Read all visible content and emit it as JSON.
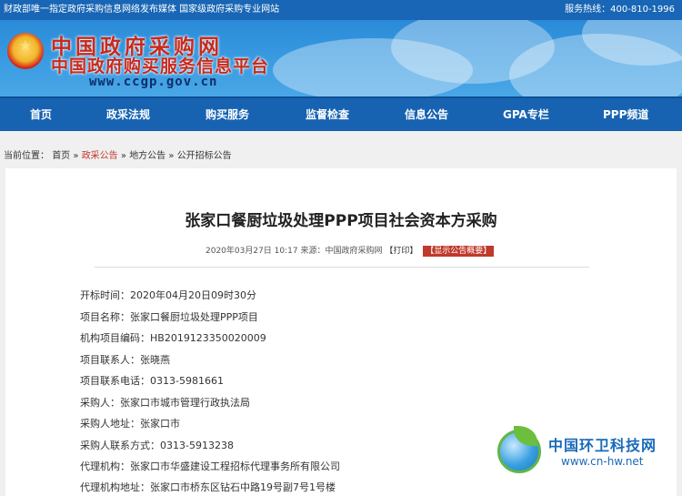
{
  "topbar": {
    "left_text": "财政部唯一指定政府采购信息网络发布媒体 国家级政府采购专业网站",
    "right_text": "服务热线：400-810-1996"
  },
  "banner": {
    "name_line1": "中国政府采购网",
    "name_line2": "中国政府购买服务信息平台",
    "url": "www.ccgp.gov.cn"
  },
  "nav": {
    "items": [
      "首页",
      "政采法规",
      "购买服务",
      "监督检查",
      "信息公告",
      "GPA专栏",
      "PPP频道"
    ]
  },
  "breadcrumb": {
    "prefix": "当前位置：",
    "items": [
      "首页",
      "政采公告",
      "地方公告",
      "公开招标公告"
    ],
    "separator": "»"
  },
  "article": {
    "title": "张家口餐厨垃圾处理PPP项目社会资本方采购",
    "date": "2020年03月27日 10:17",
    "source_label": "来源：",
    "source": "中国政府采购网",
    "print": "【打印】",
    "show_summary": "【显示公告概要】",
    "fields": [
      {
        "label": "开标时间：",
        "value": "2020年04月20日09时30分"
      },
      {
        "label": "项目名称：",
        "value": "张家口餐厨垃圾处理PPP项目"
      },
      {
        "label": "机构项目编码：",
        "value": "HB2019123350020009"
      },
      {
        "label": "项目联系人：",
        "value": "张晓燕"
      },
      {
        "label": "项目联系电话：",
        "value": "0313-5981661"
      },
      {
        "label": "采购人：",
        "value": "张家口市城市管理行政执法局"
      },
      {
        "label": "采购人地址：",
        "value": "张家口市"
      },
      {
        "label": "采购人联系方式：",
        "value": "0313-5913238"
      },
      {
        "label": "代理机构：",
        "value": "张家口市华盛建设工程招标代理事务所有限公司"
      },
      {
        "label": "代理机构地址：",
        "value": "张家口市桥东区钻石中路19号副7号1号楼"
      }
    ]
  },
  "watermark": {
    "name": "中国环卫科技网",
    "url": "www.cn-hw.net"
  },
  "colors": {
    "nav_bg": "#1763b2",
    "topbar_bg": "#1866b5",
    "accent_red": "#c0392b",
    "logo_red": "#c82a1e"
  }
}
